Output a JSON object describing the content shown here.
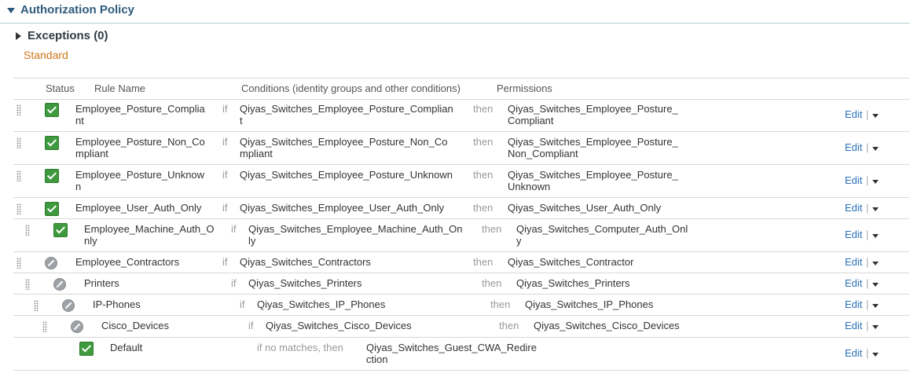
{
  "section": {
    "title": "Authorization Policy"
  },
  "exceptions": {
    "label": "Exceptions (0)"
  },
  "standard_label": "Standard",
  "columns": {
    "status": "Status",
    "rule_name": "Rule Name",
    "conditions": "Conditions (identity groups and other conditions)",
    "permissions": "Permissions"
  },
  "keywords": {
    "if": "if",
    "then": "then",
    "default_if": "if no matches, then"
  },
  "actions": {
    "edit": "Edit",
    "separator": "|"
  },
  "rules": [
    {
      "status": "enabled",
      "name": "Employee_Posture_Complia\nnt",
      "condition": "Qiyas_Switches_Employee_Posture_Complian\nt",
      "permission": "Qiyas_Switches_Employee_Posture_\nCompliant"
    },
    {
      "status": "enabled",
      "name": "Employee_Posture_Non_Co\nmpliant",
      "condition": "Qiyas_Switches_Employee_Posture_Non_Co\nmpliant",
      "permission": "Qiyas_Switches_Employee_Posture_\nNon_Compliant"
    },
    {
      "status": "enabled",
      "name": "Employee_Posture_Unknow\nn",
      "condition": "Qiyas_Switches_Employee_Posture_Unknown",
      "permission": "Qiyas_Switches_Employee_Posture_\nUnknown"
    },
    {
      "status": "enabled",
      "name": "Employee_User_Auth_Only",
      "condition": "Qiyas_Switches_Employee_User_Auth_Only",
      "permission": "Qiyas_Switches_User_Auth_Only"
    },
    {
      "status": "enabled",
      "name": "Employee_Machine_Auth_O\nnly",
      "condition": "Qiyas_Switches_Employee_Machine_Auth_On\nly",
      "permission": "Qiyas_Switches_Computer_Auth_Onl\ny"
    },
    {
      "status": "disabled",
      "name": "Employee_Contractors",
      "condition": "Qiyas_Switches_Contractors",
      "permission": "Qiyas_Switches_Contractor"
    },
    {
      "status": "disabled",
      "name": "Printers",
      "condition": "Qiyas_Switches_Printers",
      "permission": "Qiyas_Switches_Printers"
    },
    {
      "status": "disabled",
      "name": "IP-Phones",
      "condition": "Qiyas_Switches_IP_Phones",
      "permission": "Qiyas_Switches_IP_Phones"
    },
    {
      "status": "disabled",
      "name": "Cisco_Devices",
      "condition": "Qiyas_Switches_Cisco_Devices",
      "permission": "Qiyas_Switches_Cisco_Devices"
    }
  ],
  "default_rule": {
    "status": "enabled",
    "name": "Default",
    "permission": "Qiyas_Switches_Guest_CWA_Redire\nction"
  }
}
